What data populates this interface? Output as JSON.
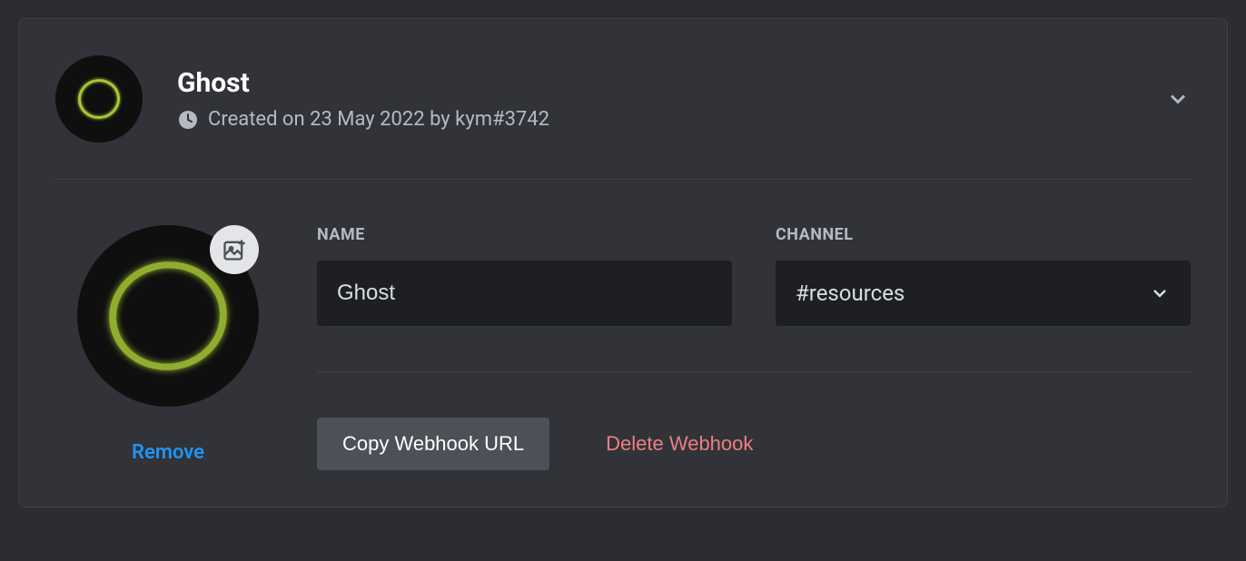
{
  "webhook": {
    "title": "Ghost",
    "meta": "Created on 23 May 2022 by kym#3742",
    "name": {
      "label": "NAME",
      "value": "Ghost"
    },
    "channel": {
      "label": "CHANNEL",
      "value": "#resources"
    },
    "actions": {
      "remove": "Remove",
      "copy": "Copy Webhook URL",
      "delete": "Delete Webhook"
    }
  }
}
